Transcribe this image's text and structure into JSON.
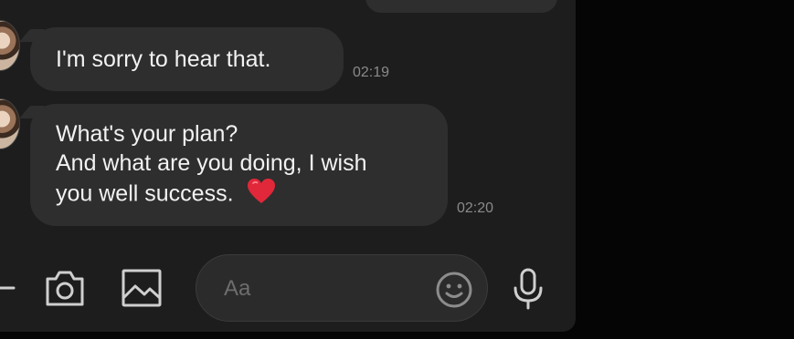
{
  "messages": [
    {
      "lines": [
        "I'm sorry to hear that."
      ],
      "time": "02:19",
      "reaction": ""
    },
    {
      "lines": [
        "What's your plan?",
        "And what are you doing, I wish",
        "you well success."
      ],
      "time": "02:20",
      "reaction": "red-heart-icon"
    }
  ],
  "composer": {
    "placeholder": "Aa",
    "value": "",
    "icons": [
      "plus-icon",
      "camera-icon",
      "image-icon",
      "emoji-icon",
      "microphone-icon"
    ]
  },
  "colors": {
    "panel_background": "#1d1d1d",
    "outside_background": "#050505",
    "bubble": "#2e2e2e",
    "bubble_text": "#f2f2f2",
    "timestamp": "#8a8a8a",
    "icon": "#cfcfcf",
    "heart": "#e0283a"
  }
}
